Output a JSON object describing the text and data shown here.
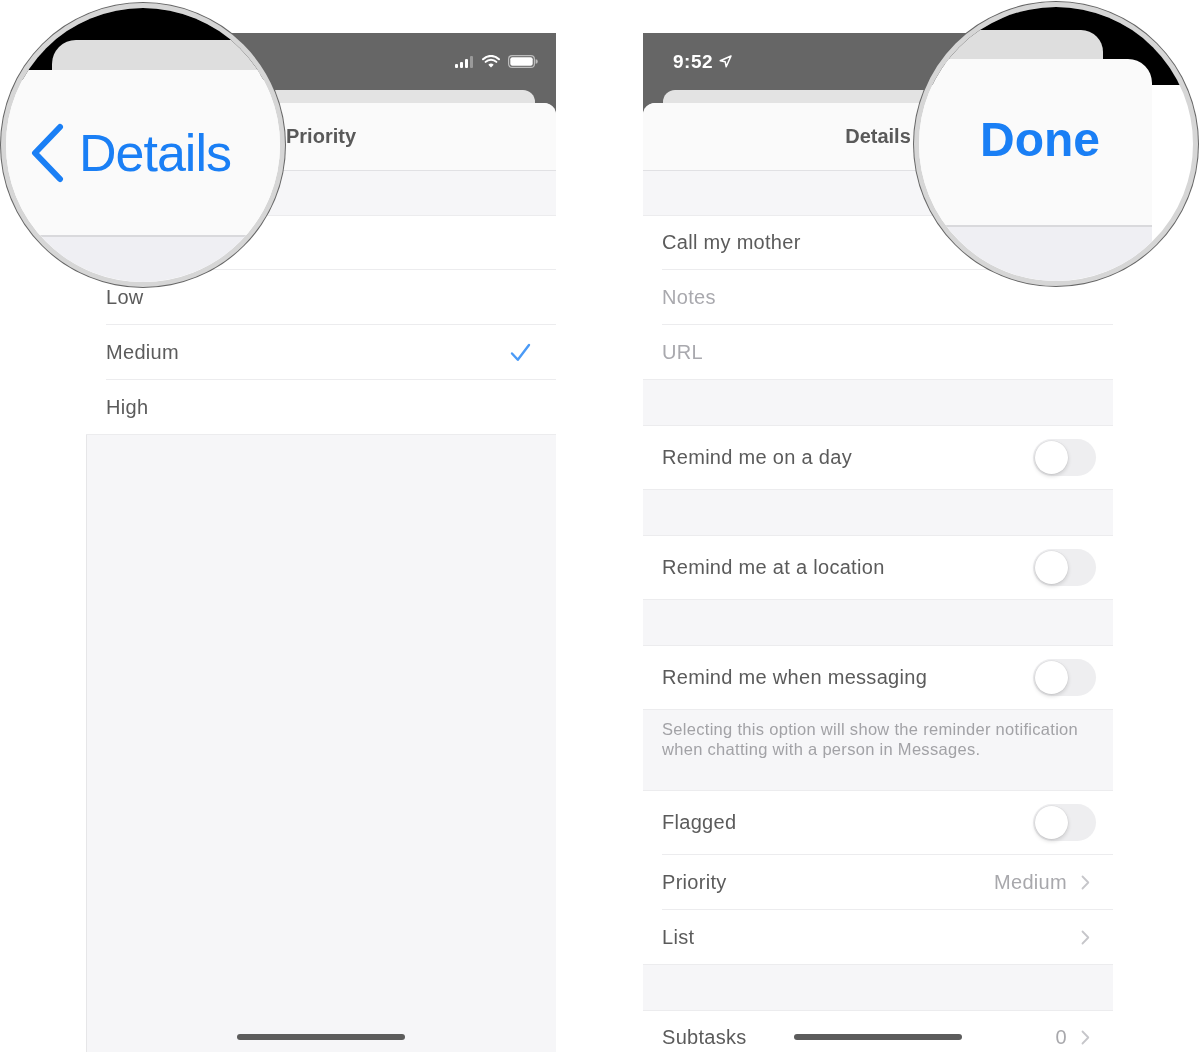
{
  "priority_screen": {
    "title": "Priority",
    "magnifier": {
      "back_label": "Details"
    },
    "options": [
      {
        "label": "Low",
        "selected": false
      },
      {
        "label": "Medium",
        "selected": true
      },
      {
        "label": "High",
        "selected": false
      }
    ]
  },
  "details_screen": {
    "time": "9:52",
    "title": "Details",
    "magnifier": {
      "done_label": "Done"
    },
    "sections": [
      {
        "rows": [
          {
            "kind": "field",
            "value": "Call my mother"
          },
          {
            "kind": "field",
            "placeholder": "Notes"
          },
          {
            "kind": "field",
            "placeholder": "URL"
          }
        ]
      },
      {
        "rows": [
          {
            "kind": "toggle",
            "label": "Remind me on a day",
            "on": false
          }
        ]
      },
      {
        "rows": [
          {
            "kind": "toggle",
            "label": "Remind me at a location",
            "on": false
          }
        ]
      },
      {
        "rows": [
          {
            "kind": "toggle",
            "label": "Remind me when messaging",
            "on": false
          }
        ],
        "footer": "Selecting this option will show the reminder notification when chatting with a person in Messages."
      },
      {
        "rows": [
          {
            "kind": "toggle",
            "label": "Flagged",
            "on": false
          },
          {
            "kind": "link",
            "label": "Priority",
            "value": "Medium"
          },
          {
            "kind": "link",
            "label": "List"
          }
        ]
      },
      {
        "rows": [
          {
            "kind": "link",
            "label": "Subtasks",
            "value": "0"
          }
        ]
      }
    ]
  }
}
